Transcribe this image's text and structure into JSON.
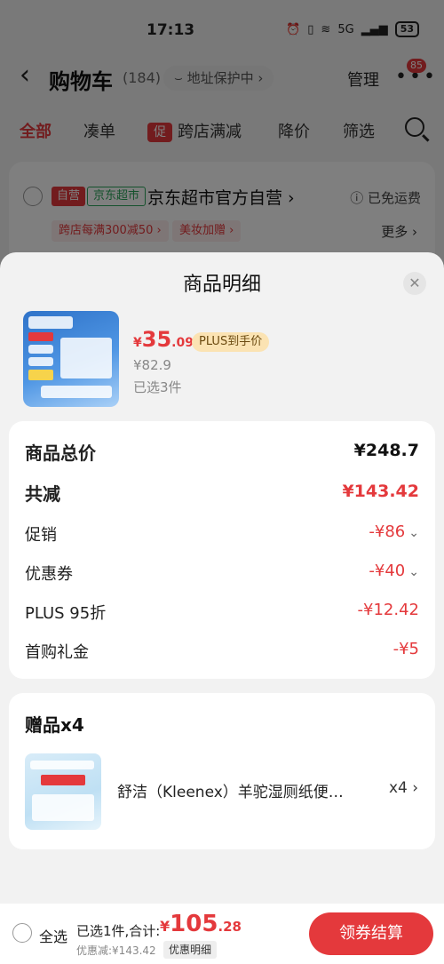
{
  "status_bar": {
    "time": "17:13",
    "network": "5G",
    "battery": "53"
  },
  "header": {
    "title": "购物车",
    "count": "(184)",
    "address_protect": "地址保护中",
    "manage": "管理",
    "msg_badge": "85"
  },
  "tabs": [
    "全部",
    "凑单",
    "跨店满减",
    "降价",
    "筛选"
  ],
  "tab_promo_badge": "促",
  "store": {
    "tag_self": "自营",
    "tag_super": "京东超市",
    "name": "京东超市官方自营",
    "free_shipping": "已免运费",
    "promo1": "跨店每满300减50",
    "promo2": "美妆加赠",
    "more": "更多"
  },
  "sheet": {
    "title": "商品明细",
    "product": {
      "price_yen": "¥",
      "price_int": "35",
      "price_dec": ".09",
      "plus_tag": "PLUS到手价",
      "orig_price": "¥82.9",
      "selected": "已选3件"
    },
    "details": {
      "total_label": "商品总价",
      "total_value": "¥248.7",
      "reduce_label": "共减",
      "reduce_value": "¥143.42",
      "promo_label": "促销",
      "promo_value": "-¥86",
      "coupon_label": "优惠券",
      "coupon_value": "-¥40",
      "plus_label": "PLUS 95折",
      "plus_value": "-¥12.42",
      "firstbuy_label": "首购礼金",
      "firstbuy_value": "-¥5"
    },
    "gift": {
      "title": "赠品x4",
      "name": "舒洁（Kleenex）羊驼湿厕纸便携装",
      "qty": "x4"
    }
  },
  "footer": {
    "select_all": "全选",
    "selected_total": "已选1件,合计:",
    "price_yen": "¥",
    "price_int": "105",
    "price_dec": ".28",
    "discount": "优惠减:¥143.42",
    "discount_detail": "优惠明细",
    "checkout": "领券结算"
  }
}
